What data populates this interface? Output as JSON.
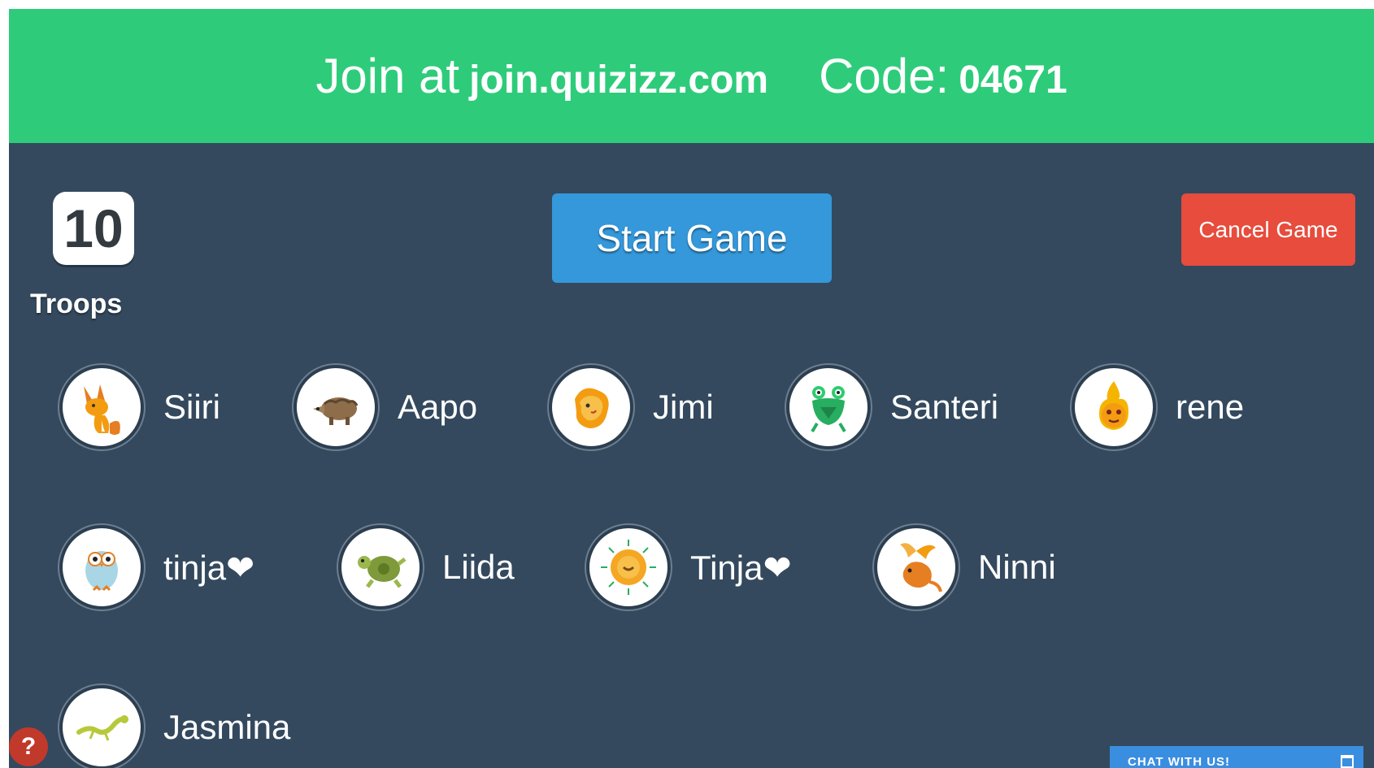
{
  "header": {
    "join_prefix": "Join at",
    "join_url": "join.quizizz.com",
    "code_prefix": "Code:",
    "code_value": "04671"
  },
  "count": {
    "value": "10",
    "label": "Troops"
  },
  "buttons": {
    "start": "Start Game",
    "cancel": "Cancel Game"
  },
  "players": [
    {
      "name": "Siiri",
      "avatar_icon": "fox-icon"
    },
    {
      "name": "Aapo",
      "avatar_icon": "armadillo-icon"
    },
    {
      "name": "Jimi",
      "avatar_icon": "fire-lion-icon"
    },
    {
      "name": "Santeri",
      "avatar_icon": "green-monster-icon"
    },
    {
      "name": "rene",
      "avatar_icon": "fireball-icon"
    },
    {
      "name": "tinja❤",
      "avatar_icon": "owl-icon"
    },
    {
      "name": "Liida",
      "avatar_icon": "turtle-icon"
    },
    {
      "name": "Tinja❤",
      "avatar_icon": "sun-flower-icon"
    },
    {
      "name": "Ninni",
      "avatar_icon": "dragon-icon"
    },
    {
      "name": "Jasmina",
      "avatar_icon": "lizard-icon"
    }
  ],
  "help": {
    "symbol": "?"
  },
  "chat": {
    "label": "CHAT WITH US!"
  },
  "colors": {
    "header_bg": "#2ecc7a",
    "page_bg": "#34495e",
    "start_btn": "#3498db",
    "cancel_btn": "#e74c3c",
    "chat_tab": "#3a8ee0"
  }
}
